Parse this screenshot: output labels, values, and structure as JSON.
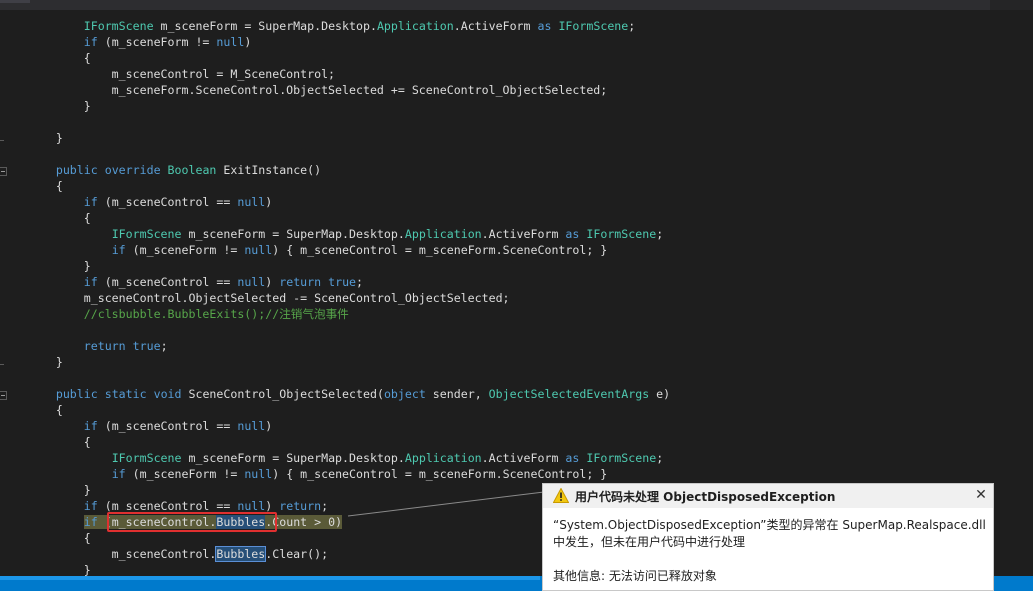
{
  "code_lines": [
    [
      {
        "t": "            "
      },
      {
        "t": "IFormScene",
        "c": "ty"
      },
      {
        "t": " m_sceneForm = SuperMap.Desktop."
      },
      {
        "t": "Application",
        "c": "ty"
      },
      {
        "t": ".ActiveForm "
      },
      {
        "t": "as",
        "c": "kw"
      },
      {
        "t": " "
      },
      {
        "t": "IFormScene",
        "c": "ty"
      },
      {
        "t": ";"
      }
    ],
    [
      {
        "t": "            "
      },
      {
        "t": "if",
        "c": "kw"
      },
      {
        "t": " (m_sceneForm != "
      },
      {
        "t": "null",
        "c": "kw"
      },
      {
        "t": ")"
      }
    ],
    [
      {
        "t": "            {"
      }
    ],
    [
      {
        "t": "                m_sceneControl = M_SceneControl;"
      }
    ],
    [
      {
        "t": "                m_sceneForm.SceneControl.ObjectSelected += SceneControl_ObjectSelected;"
      }
    ],
    [
      {
        "t": "            }"
      }
    ],
    [
      {
        "t": ""
      }
    ],
    [
      {
        "t": "        }"
      }
    ],
    [
      {
        "t": ""
      }
    ],
    [
      {
        "t": "        "
      },
      {
        "t": "public",
        "c": "kw"
      },
      {
        "t": " "
      },
      {
        "t": "override",
        "c": "kw"
      },
      {
        "t": " "
      },
      {
        "t": "Boolean",
        "c": "ty"
      },
      {
        "t": " ExitInstance()"
      }
    ],
    [
      {
        "t": "        {"
      }
    ],
    [
      {
        "t": "            "
      },
      {
        "t": "if",
        "c": "kw"
      },
      {
        "t": " (m_sceneControl == "
      },
      {
        "t": "null",
        "c": "kw"
      },
      {
        "t": ")"
      }
    ],
    [
      {
        "t": "            {"
      }
    ],
    [
      {
        "t": "                "
      },
      {
        "t": "IFormScene",
        "c": "ty"
      },
      {
        "t": " m_sceneForm = SuperMap.Desktop."
      },
      {
        "t": "Application",
        "c": "ty"
      },
      {
        "t": ".ActiveForm "
      },
      {
        "t": "as",
        "c": "kw"
      },
      {
        "t": " "
      },
      {
        "t": "IFormScene",
        "c": "ty"
      },
      {
        "t": ";"
      }
    ],
    [
      {
        "t": "                "
      },
      {
        "t": "if",
        "c": "kw"
      },
      {
        "t": " (m_sceneForm != "
      },
      {
        "t": "null",
        "c": "kw"
      },
      {
        "t": ") { m_sceneControl = m_sceneForm.SceneControl; }"
      }
    ],
    [
      {
        "t": "            }"
      }
    ],
    [
      {
        "t": "            "
      },
      {
        "t": "if",
        "c": "kw"
      },
      {
        "t": " (m_sceneControl == "
      },
      {
        "t": "null",
        "c": "kw"
      },
      {
        "t": ") "
      },
      {
        "t": "return",
        "c": "kw"
      },
      {
        "t": " "
      },
      {
        "t": "true",
        "c": "kw"
      },
      {
        "t": ";"
      }
    ],
    [
      {
        "t": "            m_sceneControl.ObjectSelected -= SceneControl_ObjectSelected;"
      }
    ],
    [
      {
        "t": "            "
      },
      {
        "t": "//clsbubble.BubbleExits();//注销气泡事件",
        "c": "cm"
      }
    ],
    [
      {
        "t": ""
      }
    ],
    [
      {
        "t": "            "
      },
      {
        "t": "return",
        "c": "kw"
      },
      {
        "t": " "
      },
      {
        "t": "true",
        "c": "kw"
      },
      {
        "t": ";"
      }
    ],
    [
      {
        "t": "        }"
      }
    ],
    [
      {
        "t": ""
      }
    ],
    [
      {
        "t": "        "
      },
      {
        "t": "public",
        "c": "kw"
      },
      {
        "t": " "
      },
      {
        "t": "static",
        "c": "kw"
      },
      {
        "t": " "
      },
      {
        "t": "void",
        "c": "kw"
      },
      {
        "t": " SceneControl_ObjectSelected("
      },
      {
        "t": "object",
        "c": "kw"
      },
      {
        "t": " sender, "
      },
      {
        "t": "ObjectSelectedEventArgs",
        "c": "ty"
      },
      {
        "t": " e)"
      }
    ],
    [
      {
        "t": "        {"
      }
    ],
    [
      {
        "t": "            "
      },
      {
        "t": "if",
        "c": "kw"
      },
      {
        "t": " (m_sceneControl == "
      },
      {
        "t": "null",
        "c": "kw"
      },
      {
        "t": ")"
      }
    ],
    [
      {
        "t": "            {"
      }
    ],
    [
      {
        "t": "                "
      },
      {
        "t": "IFormScene",
        "c": "ty"
      },
      {
        "t": " m_sceneForm = SuperMap.Desktop."
      },
      {
        "t": "Application",
        "c": "ty"
      },
      {
        "t": ".ActiveForm "
      },
      {
        "t": "as",
        "c": "kw"
      },
      {
        "t": " "
      },
      {
        "t": "IFormScene",
        "c": "ty"
      },
      {
        "t": ";"
      }
    ],
    [
      {
        "t": "                "
      },
      {
        "t": "if",
        "c": "kw"
      },
      {
        "t": " (m_sceneForm != "
      },
      {
        "t": "null",
        "c": "kw"
      },
      {
        "t": ") { m_sceneControl = m_sceneForm.SceneControl; }"
      }
    ],
    [
      {
        "t": "            }"
      }
    ],
    [
      {
        "t": "            "
      },
      {
        "t": "if",
        "c": "kw"
      },
      {
        "t": " (m_sceneControl == "
      },
      {
        "t": "null",
        "c": "kw"
      },
      {
        "t": ") "
      },
      {
        "t": "return",
        "c": "kw"
      },
      {
        "t": ";"
      }
    ],
    [
      {
        "t": "            "
      },
      {
        "t": "if",
        "c": "kw",
        "h": 1
      },
      {
        "t": " (m_sceneControl.",
        "h": 1
      },
      {
        "t": "Bubbles",
        "c": "plain",
        "h": 1,
        "s": 1
      },
      {
        "t": ".Count > 0)",
        "h": 1
      }
    ],
    [
      {
        "t": "            {"
      }
    ],
    [
      {
        "t": "                m_sceneControl."
      },
      {
        "t": "Bubbles",
        "c": "plain",
        "r": 1
      },
      {
        "t": ".Clear();"
      }
    ],
    [
      {
        "t": "            }"
      }
    ]
  ],
  "exception_popup": {
    "title": "用户代码未处理 ObjectDisposedException",
    "message_line1": "“System.ObjectDisposedException”类型的异常在 SuperMap.Realspace.dll",
    "message_line2": "中发生，但未在用户代码中进行处理",
    "additional_info": "其他信息: 无法访问已释放对象",
    "close_label": "✕",
    "icon": "warning-icon"
  },
  "colors": {
    "editor_background": "#1e1e1e",
    "keyword": "#569cd6",
    "type": "#4ec9b0",
    "comment": "#57a64a",
    "highlight_box": "#e03030",
    "status_bar": "#007acc"
  }
}
